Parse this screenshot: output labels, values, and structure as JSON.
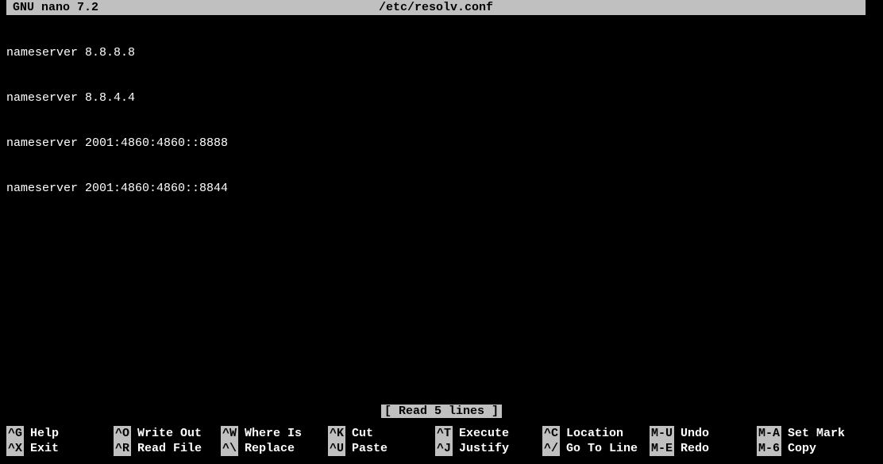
{
  "titlebar": {
    "app": "GNU nano 7.2",
    "filename": "/etc/resolv.conf"
  },
  "content": {
    "lines": [
      "nameserver 8.8.8.8",
      "nameserver 8.8.4.4",
      "nameserver 2001:4860:4860::8888",
      "nameserver 2001:4860:4860::8844"
    ]
  },
  "status": {
    "message": "[ Read 5 lines ]"
  },
  "shortcuts": {
    "row1": [
      {
        "key": "^G",
        "label": "Help"
      },
      {
        "key": "^O",
        "label": "Write Out"
      },
      {
        "key": "^W",
        "label": "Where Is"
      },
      {
        "key": "^K",
        "label": "Cut"
      },
      {
        "key": "^T",
        "label": "Execute"
      },
      {
        "key": "^C",
        "label": "Location"
      },
      {
        "key": "M-U",
        "label": "Undo"
      },
      {
        "key": "M-A",
        "label": "Set Mark"
      }
    ],
    "row2": [
      {
        "key": "^X",
        "label": "Exit"
      },
      {
        "key": "^R",
        "label": "Read File"
      },
      {
        "key": "^\\",
        "label": "Replace"
      },
      {
        "key": "^U",
        "label": "Paste"
      },
      {
        "key": "^J",
        "label": "Justify"
      },
      {
        "key": "^/",
        "label": "Go To Line"
      },
      {
        "key": "M-E",
        "label": "Redo"
      },
      {
        "key": "M-6",
        "label": "Copy"
      }
    ]
  }
}
